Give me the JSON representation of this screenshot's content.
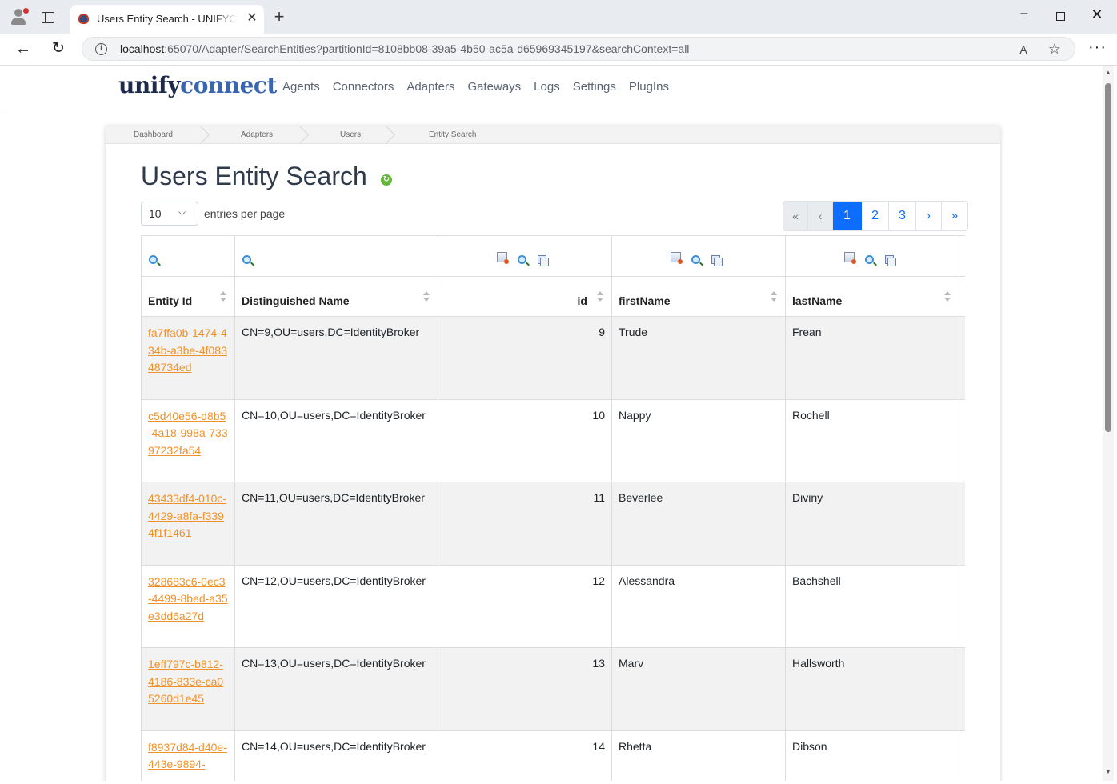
{
  "browser": {
    "tab_title": "Users Entity Search - UNIFYConnect",
    "url_host": "localhost",
    "url_rest": ":65070/Adapter/SearchEntities?partitionId=8108bb08-39a5-4b50-ac5a-d65969345197&searchContext=all"
  },
  "icons": {
    "tab_close": "✕",
    "new_tab": "+",
    "minimize": "–",
    "close_window": "✕",
    "back": "←",
    "reload": "↻",
    "info": "i",
    "read_aloud": "A",
    "favorite": "☆",
    "more": "···",
    "refresh": "↻",
    "chevron": "⌵"
  },
  "site": {
    "logo_part1": "unify",
    "logo_part2": "connect",
    "nav": [
      "Agents",
      "Connectors",
      "Adapters",
      "Gateways",
      "Logs",
      "Settings",
      "PlugIns"
    ]
  },
  "breadcrumb": [
    "Dashboard",
    "Adapters",
    "Users",
    "Entity Search"
  ],
  "page": {
    "title": "Users Entity Search",
    "page_size": "10",
    "entries_label": "entries per page"
  },
  "pagination": {
    "first": "«",
    "prev": "‹",
    "pages": [
      "1",
      "2",
      "3"
    ],
    "active_page": "1",
    "next": "›",
    "last": "»"
  },
  "table": {
    "columns": [
      "Entity Id",
      "Distinguished Name",
      "id",
      "firstName",
      "lastName"
    ],
    "rows": [
      {
        "entity_id": "fa7ffa0b-1474-434b-a3be-4f08348734ed",
        "dn": "CN=9,OU=users,DC=IdentityBroker",
        "id": "9",
        "first": "Trude",
        "last": "Frean"
      },
      {
        "entity_id": "c5d40e56-d8b5-4a18-998a-73397232fa54",
        "dn": "CN=10,OU=users,DC=IdentityBroker",
        "id": "10",
        "first": "Nappy",
        "last": "Rochell"
      },
      {
        "entity_id": "43433df4-010c-4429-a8fa-f3394f1f1461",
        "dn": "CN=11,OU=users,DC=IdentityBroker",
        "id": "11",
        "first": "Beverlee",
        "last": "Diviny"
      },
      {
        "entity_id": "328683c6-0ec3-4499-8bed-a35e3dd6a27d",
        "dn": "CN=12,OU=users,DC=IdentityBroker",
        "id": "12",
        "first": "Alessandra",
        "last": "Bachshell"
      },
      {
        "entity_id": "1eff797c-b812-4186-833e-ca05260d1e45",
        "dn": "CN=13,OU=users,DC=IdentityBroker",
        "id": "13",
        "first": "Marv",
        "last": "Hallsworth"
      },
      {
        "entity_id": "f8937d84-d40e-443e-9894-",
        "dn": "CN=14,OU=users,DC=IdentityBroker",
        "id": "14",
        "first": "Rhetta",
        "last": "Dibson"
      }
    ]
  }
}
